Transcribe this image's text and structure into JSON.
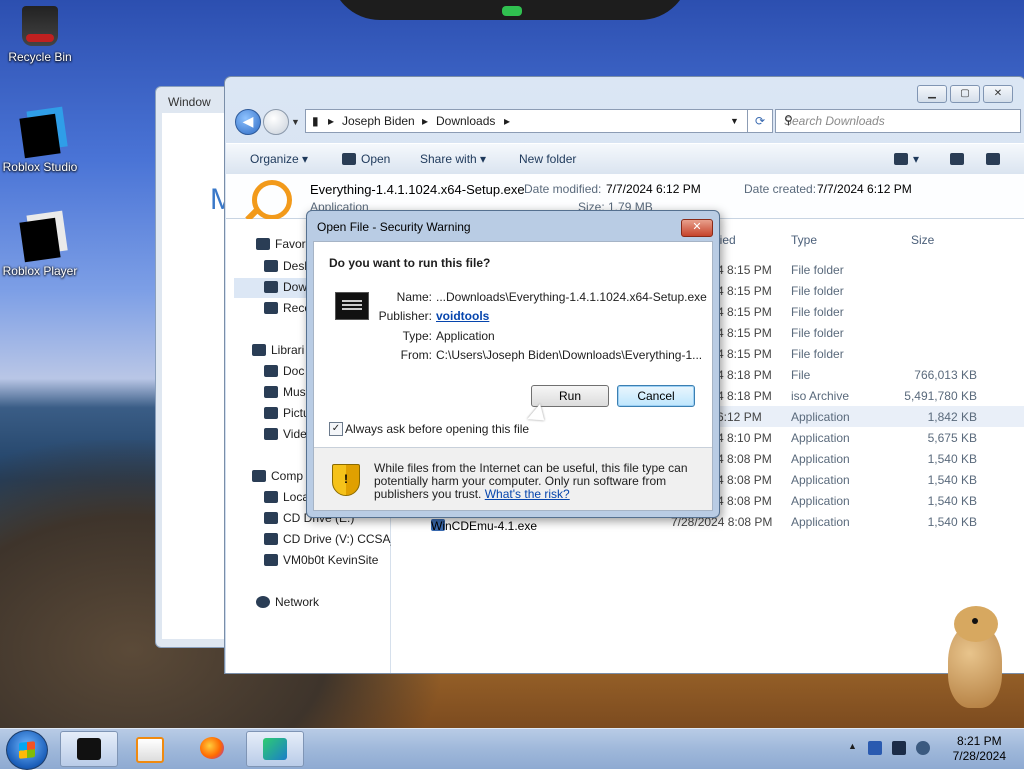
{
  "desktop": {
    "icons": [
      {
        "label": "Recycle Bin",
        "icon": "recycle-bin-icon"
      },
      {
        "label": "Roblox Studio",
        "icon": "roblox-studio-icon"
      },
      {
        "label": "Roblox Player",
        "icon": "roblox-player-icon"
      }
    ]
  },
  "bg_window": {
    "title": "Window",
    "letter": "M"
  },
  "explorer": {
    "breadcrumb": [
      "Joseph Biden",
      "Downloads"
    ],
    "search_placeholder": "Search Downloads",
    "toolbar": {
      "organize": "Organize",
      "open": "Open",
      "share_with": "Share with",
      "new_folder": "New folder"
    },
    "details": {
      "filename": "Everything-1.4.1.1024.x64-Setup.exe",
      "date_modified_label": "Date modified:",
      "date_modified": "7/7/2024 6:12 PM",
      "date_created_label": "Date created:",
      "date_created": "7/7/2024 6:12 PM",
      "type_partial": "Application",
      "size_partial": "Size: 1.79 MB"
    },
    "nav": {
      "favorites": "Favori",
      "desktop": "Desk",
      "downloads": "Dow",
      "recent": "Rece",
      "libraries": "Librari",
      "documents": "Doc",
      "music": "Mus",
      "pictures": "Pictu",
      "videos": "Vide",
      "computer": "Comp",
      "local": "Loca",
      "cd_drive_e": "CD Drive (E:)",
      "cd_drive_v": "CD Drive (V:) CCSA_",
      "vmobot": "VM0b0t KevinSite",
      "network": "Network"
    },
    "columns": {
      "date": "dified",
      "type": "Type",
      "size": "Size"
    },
    "rows": [
      {
        "name": "",
        "date": "4 8:15 PM",
        "type": "File folder",
        "size": ""
      },
      {
        "name": "",
        "date": "4 8:15 PM",
        "type": "File folder",
        "size": ""
      },
      {
        "name": "",
        "date": "4 8:15 PM",
        "type": "File folder",
        "size": ""
      },
      {
        "name": "",
        "date": "4 8:15 PM",
        "type": "File folder",
        "size": ""
      },
      {
        "name": "",
        "date": "4 8:15 PM",
        "type": "File folder",
        "size": ""
      },
      {
        "name": "",
        "date": "4 8:18 PM",
        "type": "File",
        "size": "766,013 KB"
      },
      {
        "name": "",
        "date": "4 8:18 PM",
        "type": "iso Archive",
        "size": "5,491,780 KB"
      },
      {
        "name": "",
        "date": "6:12 PM",
        "type": "Application",
        "size": "1,842 KB"
      },
      {
        "name": "",
        "date": "4 8:10 PM",
        "type": "Application",
        "size": "5,675 KB"
      },
      {
        "name": "",
        "date": "4 8:08 PM",
        "type": "Application",
        "size": "1,540 KB"
      },
      {
        "name": "",
        "date": "4 8:08 PM",
        "type": "Application",
        "size": "1,540 KB"
      },
      {
        "name": "",
        "date": "4 8:08 PM",
        "type": "Application",
        "size": "1,540 KB"
      },
      {
        "name": "WinCDEmu-4.1.exe",
        "date": "7/28/2024 8:08 PM",
        "type": "Application",
        "size": "1,540 KB"
      }
    ]
  },
  "dialog": {
    "title": "Open File - Security Warning",
    "close": "✕",
    "question": "Do you want to run this file?",
    "name_label": "Name:",
    "name_value": "...Downloads\\Everything-1.4.1.1024.x64-Setup.exe",
    "publisher_label": "Publisher:",
    "publisher_value": "voidtools",
    "type_label": "Type:",
    "type_value": "Application",
    "from_label": "From:",
    "from_value": "C:\\Users\\Joseph Biden\\Downloads\\Everything-1...",
    "run": "Run",
    "cancel": "Cancel",
    "checkbox_label": "Always ask before opening this file",
    "checkbox_checked": "✓",
    "warning_text": "While files from the Internet can be useful, this file type can potentially harm your computer. Only run software from publishers you trust.",
    "risk_link": "What's the risk?"
  },
  "taskbar": {
    "time": "8:21 PM",
    "date": "7/28/2024",
    "tray_arrow": "▲"
  }
}
